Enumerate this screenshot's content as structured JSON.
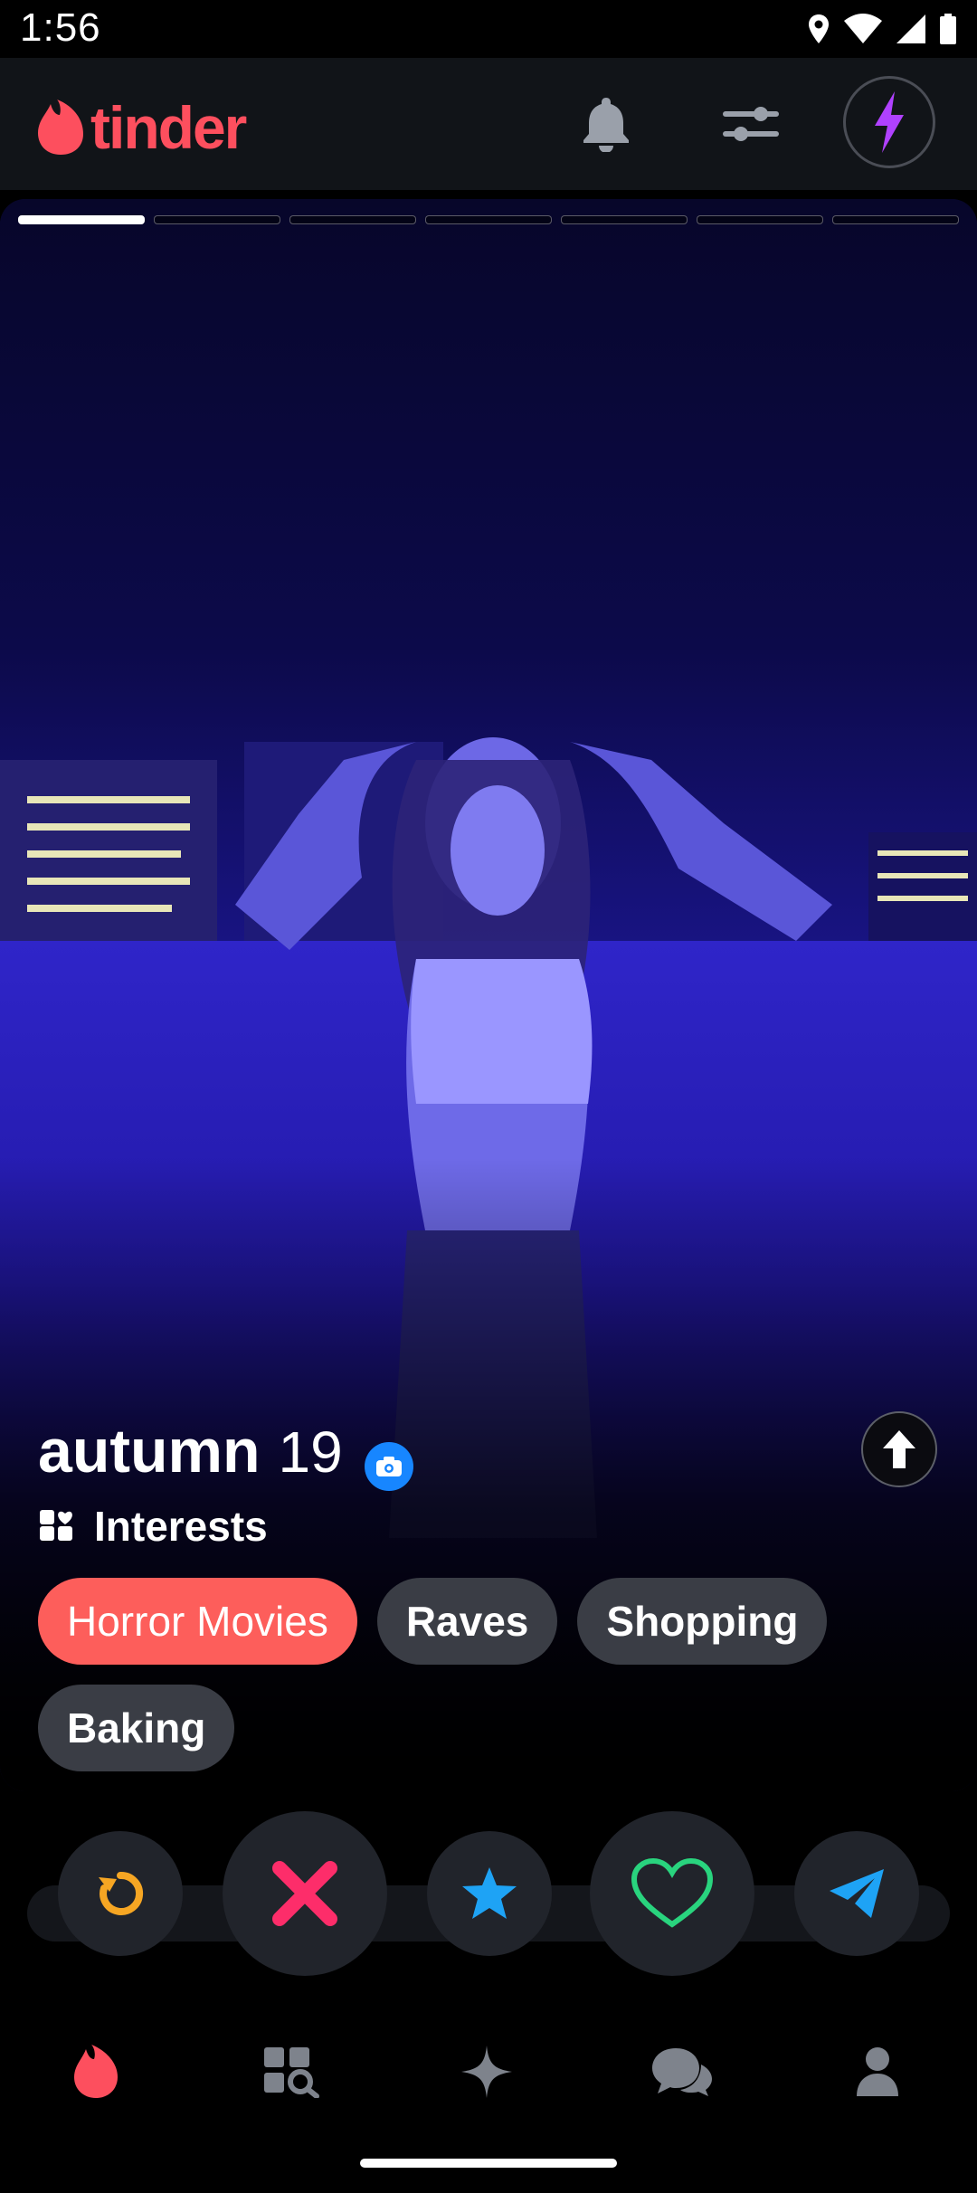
{
  "status_bar": {
    "time": "1:56",
    "icons": [
      "location-icon",
      "wifi-icon",
      "signal-icon",
      "battery-icon"
    ]
  },
  "header": {
    "logo_text": "tinder",
    "brand_color": "#fd4f5e",
    "buttons": [
      "bell-icon",
      "filters-icon",
      "boost-icon"
    ]
  },
  "card": {
    "photo_count": 7,
    "active_photo": 1,
    "name": "autumn",
    "age": "19",
    "verified_icon": "camera-icon",
    "interests_label": "Interests",
    "interests": [
      "Horror Movies",
      "Raves",
      "Shopping",
      "Baking"
    ],
    "shared_interest": "Horror Movies"
  },
  "actions": {
    "rewind_color": "#f6a623",
    "nope_color": "#fd2d6a",
    "super_like_color": "#1ea3f5",
    "like_color": "#29d47e",
    "boost_color": "#1ea3f5"
  },
  "nav": {
    "items": [
      "home-icon",
      "explore-icon",
      "gold-icon",
      "messages-icon",
      "profile-icon"
    ],
    "active": "home-icon"
  }
}
